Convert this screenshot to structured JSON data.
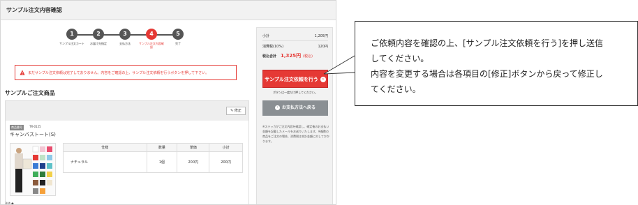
{
  "page": {
    "title": "サンプル注文内容確認"
  },
  "steps": [
    {
      "num": "1",
      "label": "サンプル注文カート"
    },
    {
      "num": "2",
      "label": "お届け先指定"
    },
    {
      "num": "3",
      "label": "支払方法"
    },
    {
      "num": "4",
      "label": "サンプル注文内容確認"
    },
    {
      "num": "5",
      "label": "完了"
    }
  ],
  "alert": {
    "text": "まだサンプル注文依頼は完了しておりません。内容をご確認の上、サンプル注文依頼を行うボタンを押して下さい。"
  },
  "section": {
    "title": "サンプルご注文商品"
  },
  "product": {
    "edit_label": "修正",
    "code_label": "商品番号",
    "code": "TR-0125",
    "name": "キャンバストート(S)",
    "table": {
      "headers": [
        "仕様",
        "数量",
        "単価",
        "小計"
      ],
      "rows": [
        [
          "ナチュラル",
          "1個",
          "200円",
          "200円"
        ]
      ]
    }
  },
  "footer": {
    "fragment": "決済"
  },
  "summary": {
    "subtotal_label": "小計",
    "subtotal_value": "1,205円",
    "tax_label": "消費税(10%)",
    "tax_value": "120円",
    "total_label": "税込合計",
    "total_value": "1,325円",
    "total_note": "(税込)",
    "order_button": "サンプル注文依頼を行う",
    "order_note": "ボタンは一度だけ押してください。",
    "back_button": "お支払方法へ戻る",
    "notes": "※ステッカがご注文内容を確認し、確定後のお支払い金額を記載したメールをお送りいたします。※複数の商品をご注文の場合、消費税は合計金額に対してかかります。"
  },
  "callout": {
    "line1": "ご依頼内容を確認の上、[サンプル注文依頼を行う]を押し送信",
    "line2": "してください。",
    "line3": "内容を変更する場合は各項目の[修正]ボタンから戻って修正し",
    "line4": "てください。"
  },
  "colors": {
    "accent": "#e53935",
    "step": "#555555",
    "back_button": "#8a8f93"
  }
}
